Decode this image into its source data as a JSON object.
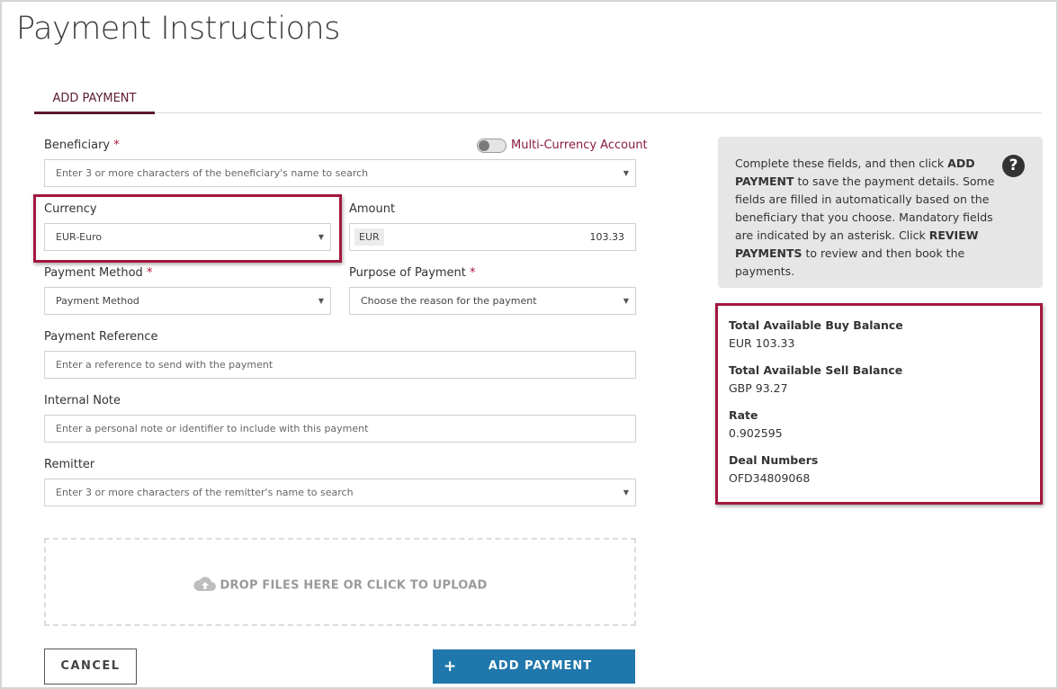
{
  "page": {
    "title": "Payment Instructions"
  },
  "tabs": [
    {
      "label": "ADD PAYMENT"
    }
  ],
  "form": {
    "beneficiary": {
      "label": "Beneficiary",
      "required": "*",
      "placeholder": "Enter 3 or more characters of the beneficiary's name to search"
    },
    "multi_currency": {
      "label": "Multi-Currency Account",
      "enabled": false
    },
    "currency": {
      "label": "Currency",
      "value": "EUR-Euro"
    },
    "amount": {
      "label": "Amount",
      "currency_code": "EUR",
      "value": "103.33"
    },
    "payment_method": {
      "label": "Payment Method",
      "required": "*",
      "value": "Payment Method"
    },
    "purpose": {
      "label": "Purpose of Payment",
      "required": "*",
      "value": "Choose the reason for the payment"
    },
    "payment_reference": {
      "label": "Payment Reference",
      "placeholder": "Enter a reference to send with the payment"
    },
    "internal_note": {
      "label": "Internal Note",
      "placeholder": "Enter a personal note or identifier to include with this payment"
    },
    "remitter": {
      "label": "Remitter",
      "placeholder": "Enter 3 or more characters of the remitter's name to search"
    },
    "dropzone_label": "DROP FILES HERE OR CLICK TO UPLOAD"
  },
  "actions": {
    "cancel_label": "CANCEL",
    "add_label": "ADD PAYMENT",
    "add_icon": "+"
  },
  "info": {
    "p1": "Complete these fields, and then click ",
    "b1": "ADD PAYMENT",
    "p2": " to save the payment details. Some fields are filled in automatically based on the beneficiary that you choose. Mandatory fields are indicated by an asterisk. Click ",
    "b2": "REVIEW PAYMENTS",
    "p3": " to review and then book the payments.",
    "help_icon": "?"
  },
  "balances": [
    {
      "label": "Total Available Buy Balance",
      "value": "EUR 103.33"
    },
    {
      "label": "Total Available Sell Balance",
      "value": "GBP 93.27"
    },
    {
      "label": "Rate",
      "value": "0.902595"
    },
    {
      "label": "Deal Numbers",
      "value": "OFD34809068"
    }
  ],
  "colors": {
    "accent": "#5c1a33",
    "highlight": "#a3173f",
    "primary_button": "#2077ab"
  }
}
